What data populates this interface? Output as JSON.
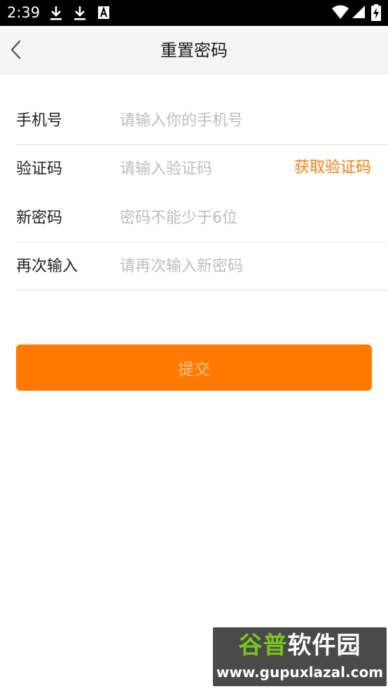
{
  "status_bar": {
    "time": "2:39",
    "icons": [
      "download-icon",
      "download-icon",
      "a-letter-icon",
      "wifi-icon",
      "signal-icon",
      "battery-icon"
    ]
  },
  "nav": {
    "title": "重置密码",
    "back_icon": "chevron-left-icon"
  },
  "form": {
    "phone": {
      "label": "手机号",
      "placeholder": "请输入你的手机号",
      "value": ""
    },
    "code": {
      "label": "验证码",
      "placeholder": "请输入验证码",
      "value": "",
      "get_code_label": "获取验证码"
    },
    "new_password": {
      "label": "新密码",
      "placeholder": "密码不能少于6位",
      "value": ""
    },
    "confirm_password": {
      "label": "再次输入",
      "placeholder": "请再次输入新密码",
      "value": ""
    }
  },
  "submit_label": "提交",
  "watermark": {
    "name_green": "谷普",
    "name_white": "软件园",
    "url": "www.gupuxlazal.com"
  },
  "colors": {
    "accent": "#ff7800",
    "accent_text": "#ff7a00",
    "submit_text": "#ffc58f",
    "placeholder": "#bdbdbd",
    "status_bar": "#000000",
    "nav_bg": "#f5f5f5"
  }
}
